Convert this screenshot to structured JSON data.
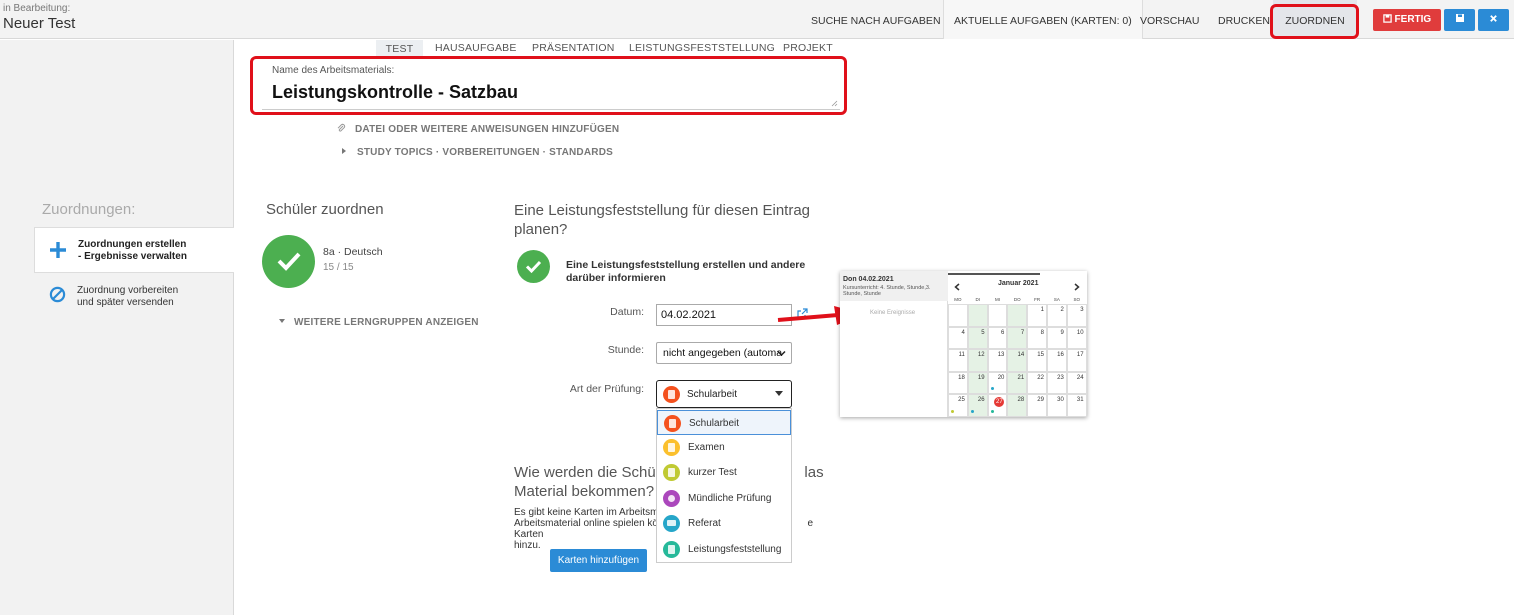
{
  "header": {
    "editing_label": "in Bearbeitung:",
    "title": "Neuer Test",
    "nav": [
      "SUCHE NACH AUFGABEN",
      "AKTUELLE AUFGABEN (KARTEN: 0)",
      "VORSCHAU",
      "DRUCKEN",
      "ZUORDNEN"
    ],
    "fertig_label": "FERTIG"
  },
  "sidebar": {
    "heading": "Zuordnungen:",
    "items": [
      {
        "line1": "Zuordnungen erstellen",
        "line2": "- Ergebnisse verwalten"
      },
      {
        "line1": "Zuordnung vorbereiten",
        "line2": "und später versenden"
      }
    ]
  },
  "tabs": [
    "TEST",
    "HAUSAUFGABE",
    "PRÄSENTATION",
    "LEISTUNGSFESTSTELLUNG",
    "PROJEKT"
  ],
  "material": {
    "label": "Name des Arbeitsmaterials:",
    "value": "Leistungskontrolle - Satzbau"
  },
  "links": {
    "attach": "DATEI ODER WEITERE ANWEISUNGEN HINZUFÜGEN",
    "topics": "STUDY TOPICS · VORBEREITUNGEN · STANDARDS"
  },
  "students": {
    "title": "Schüler zuordnen",
    "group": "8a · Deutsch",
    "count": "15 / 15",
    "more": "WEITERE LERNGRUPPEN ANZEIGEN"
  },
  "assessment": {
    "title": "Eine Leistungsfeststellung für diesen Eintrag planen?",
    "create": "Eine Leistungsfeststellung erstellen und andere darüber informieren",
    "date_label": "Datum:",
    "date_value": "04.02.2021",
    "lesson_label": "Stunde:",
    "lesson_value": "nicht angegeben (automa",
    "type_label": "Art der Prüfung:",
    "type_value": "Schularbeit",
    "options": [
      {
        "label": "Schularbeit",
        "color": "#f4511e"
      },
      {
        "label": "Examen",
        "color": "#fbc02d"
      },
      {
        "label": "kurzer Test",
        "color": "#c0ca33"
      },
      {
        "label": "Mündliche Prüfung",
        "color": "#ab47bc"
      },
      {
        "label": "Referat",
        "color": "#26a6c9"
      },
      {
        "label": "Leistungsfeststellung",
        "color": "#26b99a"
      }
    ]
  },
  "cards": {
    "title_a": "Wie werden die Schüle",
    "title_b": "las",
    "title_c": "Material bekommen?",
    "line1a": "Es gibt keine Karten im Arbeitsma",
    "line2a": "Arbeitsmaterial online spielen kön",
    "line2b": "e Karten",
    "line3": "hinzu.",
    "button": "Karten hinzufügen"
  },
  "calendar": {
    "date": "Don 04.02.2021",
    "info": "Kursunterricht: 4. Stunde, Stunde,3. Stunde, Stunde",
    "empty": "Keine Ereignisse",
    "month": "Januar 2021",
    "weekdays": [
      "MO",
      "DI",
      "MI",
      "DO",
      "FR",
      "SA",
      "SO"
    ],
    "weeks": [
      [
        "",
        "",
        "",
        "",
        "1",
        "2",
        "3"
      ],
      [
        "4",
        "5",
        "6",
        "7",
        "8",
        "9",
        "10"
      ],
      [
        "11",
        "12",
        "13",
        "14",
        "15",
        "16",
        "17"
      ],
      [
        "18",
        "19",
        "20",
        "21",
        "22",
        "23",
        "24"
      ],
      [
        "25",
        "26",
        "27",
        "28",
        "29",
        "30",
        "31"
      ]
    ],
    "today": "27"
  }
}
